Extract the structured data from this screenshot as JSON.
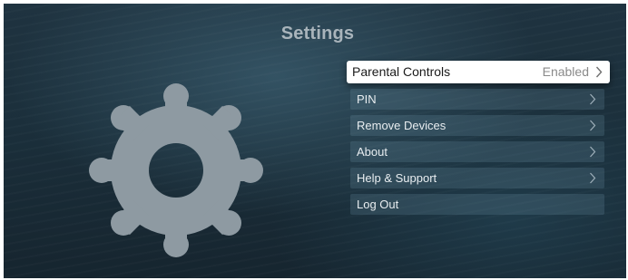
{
  "header": {
    "title": "Settings"
  },
  "hero": {
    "icon": "gear-icon",
    "color": "#8e9aa2"
  },
  "menu": {
    "items": [
      {
        "label": "Parental Controls",
        "value": "Enabled",
        "focused": true,
        "icon": "chevron-right-icon"
      },
      {
        "label": "PIN",
        "value": "",
        "focused": false,
        "icon": "chevron-right-icon"
      },
      {
        "label": "Remove Devices",
        "value": "",
        "focused": false,
        "icon": "chevron-right-icon"
      },
      {
        "label": "About",
        "value": "",
        "focused": false,
        "icon": "chevron-right-icon"
      },
      {
        "label": "Help & Support",
        "value": "",
        "focused": false,
        "icon": "chevron-right-icon"
      },
      {
        "label": "Log Out",
        "value": "",
        "focused": false,
        "icon": ""
      }
    ]
  },
  "colors": {
    "focus_bg": "#ffffff",
    "item_text": "#e8edf0",
    "title_text": "#a9b4bb"
  }
}
